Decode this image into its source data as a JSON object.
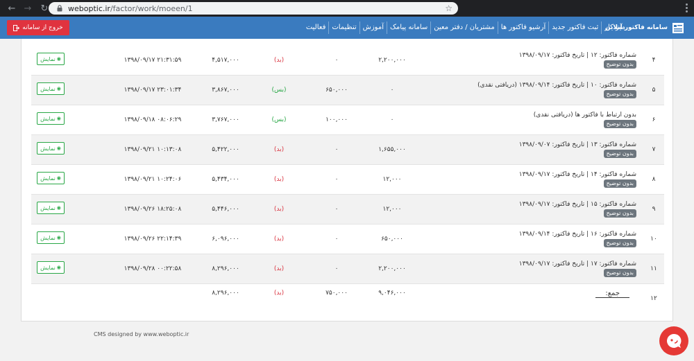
{
  "browser": {
    "url_host": "weboptic.ir",
    "url_path": "/factor/work/moeen/1"
  },
  "navbar": {
    "brand": "سامانه فاکتور آنلاین",
    "menu": [
      "میز کار",
      "ثبت فاکتور جدید",
      "آرشیو فاکتور ها",
      "مشتریان / دفتر معین",
      "سامانه پیامک",
      "آموزش",
      "تنظیمات",
      "فعالیت"
    ],
    "logout_label": "خروج از سامانه"
  },
  "table": {
    "badge_label": "بدون توضیح",
    "show_label": "نمایش",
    "rows": [
      {
        "num": "۴",
        "desc": "شماره فاکتور: ۱۲ | تاریخ فاکتور: ۱۳۹۸/۰۹/۱۷",
        "val1": "۲,۲۰۰,۰۰۰",
        "val2": "۰",
        "status": "(بد)",
        "status_type": "bed",
        "balance": "۴,۵۱۷,۰۰۰",
        "date": "۱۳۹۸/۰۹/۱۷ ۲۱:۳۱:۵۹"
      },
      {
        "num": "۵",
        "desc": "شماره فاکتور: ۱۰ | تاریخ فاکتور: ۱۳۹۸/۰۹/۱۴ (دریافتی نقدی)",
        "val1": "۰",
        "val2": "۶۵۰,۰۰۰",
        "status": "(بس)",
        "status_type": "bes",
        "balance": "۳,۸۶۷,۰۰۰",
        "date": "۱۳۹۸/۰۹/۱۷ ۲۳:۰۱:۳۴"
      },
      {
        "num": "۶",
        "desc": "بدون ارتباط با فاکتور ها (دریافتی نقدی)",
        "val1": "۰",
        "val2": "۱۰۰,۰۰۰",
        "status": "(بس)",
        "status_type": "bes",
        "balance": "۳,۷۶۷,۰۰۰",
        "date": "۱۳۹۸/۰۹/۱۸ ۰۸:۰۶:۲۹"
      },
      {
        "num": "۷",
        "desc": "شماره فاکتور: ۱۳ | تاریخ فاکتور: ۱۳۹۸/۰۹/۰۷",
        "val1": "۱,۶۵۵,۰۰۰",
        "val2": "۰",
        "status": "(بد)",
        "status_type": "bed",
        "balance": "۵,۴۲۲,۰۰۰",
        "date": "۱۳۹۸/۰۹/۲۱ ۱۰:۱۳:۰۸"
      },
      {
        "num": "۸",
        "desc": "شماره فاکتور: ۱۴ | تاریخ فاکتور: ۱۳۹۸/۰۹/۱۷",
        "val1": "۱۲,۰۰۰",
        "val2": "۰",
        "status": "(بد)",
        "status_type": "bed",
        "balance": "۵,۴۳۴,۰۰۰",
        "date": "۱۳۹۸/۰۹/۲۱ ۱۰:۲۴:۰۶"
      },
      {
        "num": "۹",
        "desc": "شماره فاکتور: ۱۵ | تاریخ فاکتور: ۱۳۹۸/۰۹/۱۷",
        "val1": "۱۲,۰۰۰",
        "val2": "۰",
        "status": "(بد)",
        "status_type": "bed",
        "balance": "۵,۴۴۶,۰۰۰",
        "date": "۱۳۹۸/۰۹/۲۶ ۱۸:۲۵:۰۸"
      },
      {
        "num": "۱۰",
        "desc": "شماره فاکتور: ۱۶ | تاریخ فاکتور: ۱۳۹۸/۰۹/۱۴",
        "val1": "۶۵۰,۰۰۰",
        "val2": "۰",
        "status": "(بد)",
        "status_type": "bed",
        "balance": "۶,۰۹۶,۰۰۰",
        "date": "۱۳۹۸/۰۹/۲۶ ۲۲:۱۴:۳۹"
      },
      {
        "num": "۱۱",
        "desc": "شماره فاکتور: ۱۷ | تاریخ فاکتور: ۱۳۹۸/۰۹/۱۷",
        "val1": "۲,۲۰۰,۰۰۰",
        "val2": "۰",
        "status": "(بد)",
        "status_type": "bed",
        "balance": "۸,۲۹۶,۰۰۰",
        "date": "۱۳۹۸/۰۹/۲۸ ۰۰:۲۲:۵۸"
      }
    ],
    "total": {
      "num": "۱۲",
      "label": "جمع:",
      "val1": "۹,۰۴۶,۰۰۰",
      "val2": "۷۵۰,۰۰۰",
      "status": "(بد)",
      "balance": "۸,۲۹۶,۰۰۰"
    }
  },
  "footer": {
    "text": "CMS designed by www.weboptic.ir"
  },
  "colors": {
    "navbar": "#3a7bbf",
    "logout": "#e0333f",
    "bed": "#d9333f",
    "bes": "#28a745",
    "badge": "#6c757d"
  }
}
